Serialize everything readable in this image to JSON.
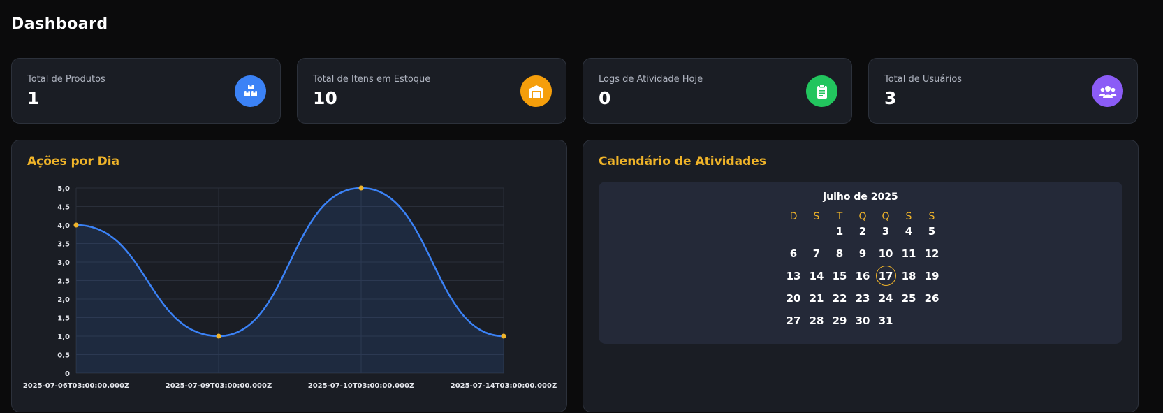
{
  "page": {
    "title": "Dashboard"
  },
  "stats": [
    {
      "label": "Total de Produtos",
      "value": "1",
      "icon": "boxes-icon",
      "color": "#3b82f6"
    },
    {
      "label": "Total de Itens em Estoque",
      "value": "10",
      "icon": "warehouse-icon",
      "color": "#f59e0b"
    },
    {
      "label": "Logs de Atividade Hoje",
      "value": "0",
      "icon": "clipboard-list-icon",
      "color": "#22c55e"
    },
    {
      "label": "Total de Usuários",
      "value": "3",
      "icon": "users-icon",
      "color": "#8b5cf6"
    }
  ],
  "actions_panel": {
    "title": "Ações por Dia"
  },
  "calendar_panel": {
    "title": "Calendário de Atividades",
    "month_label": "julho de 2025",
    "weekdays": [
      "D",
      "S",
      "T",
      "Q",
      "Q",
      "S",
      "S"
    ],
    "first_weekday_index": 2,
    "days_in_month": 31,
    "highlighted_day": 17
  },
  "colors": {
    "accent": "#f0b429",
    "line": "#3b82f6",
    "point": "#f0b429",
    "card": "#1a1d24",
    "background": "#0b0b0c"
  },
  "chart_data": {
    "type": "line",
    "title": "Ações por Dia",
    "x": [
      "2025-07-06T03:00:00.000Z",
      "2025-07-09T03:00:00.000Z",
      "2025-07-10T03:00:00.000Z",
      "2025-07-14T03:00:00.000Z"
    ],
    "series": [
      {
        "values": [
          4,
          1,
          5,
          1
        ]
      }
    ],
    "y_ticks": [
      "0",
      "0,5",
      "1,0",
      "1,5",
      "2,0",
      "2,5",
      "3,0",
      "3,5",
      "4,0",
      "4,5",
      "5,0"
    ],
    "ylim": [
      0,
      5
    ],
    "grid": true,
    "fill": "area",
    "curve": "smooth",
    "xlabel": "",
    "ylabel": ""
  }
}
